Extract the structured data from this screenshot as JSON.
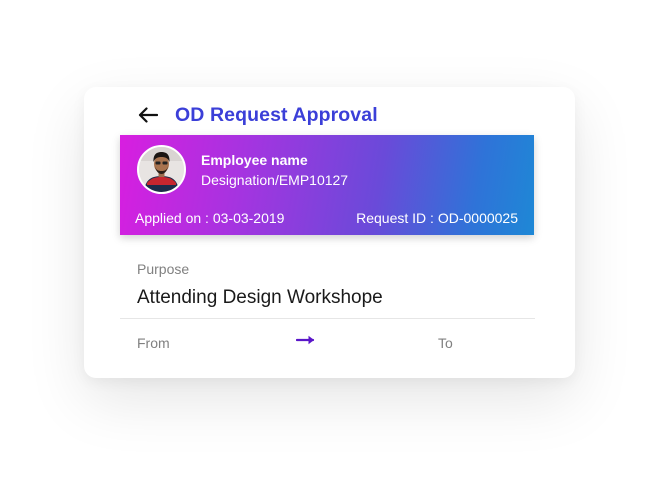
{
  "header": {
    "title": "OD Request Approval",
    "back_icon": "arrow-left-icon"
  },
  "employee": {
    "name": "Employee name",
    "designation": "Designation/EMP10127",
    "applied_on": "Applied on : 03-03-2019",
    "request_id": "Request ID : OD-0000025"
  },
  "purpose": {
    "label": "Purpose",
    "value": "Attending Design Workshope"
  },
  "dates": {
    "from_label": "From",
    "to_label": "To",
    "arrow_icon": "arrow-right-icon"
  },
  "colors": {
    "title": "#3b3fd8",
    "gradient_start": "#d81ee0",
    "gradient_end": "#1e88d6",
    "arrow": "#5a16c9"
  }
}
